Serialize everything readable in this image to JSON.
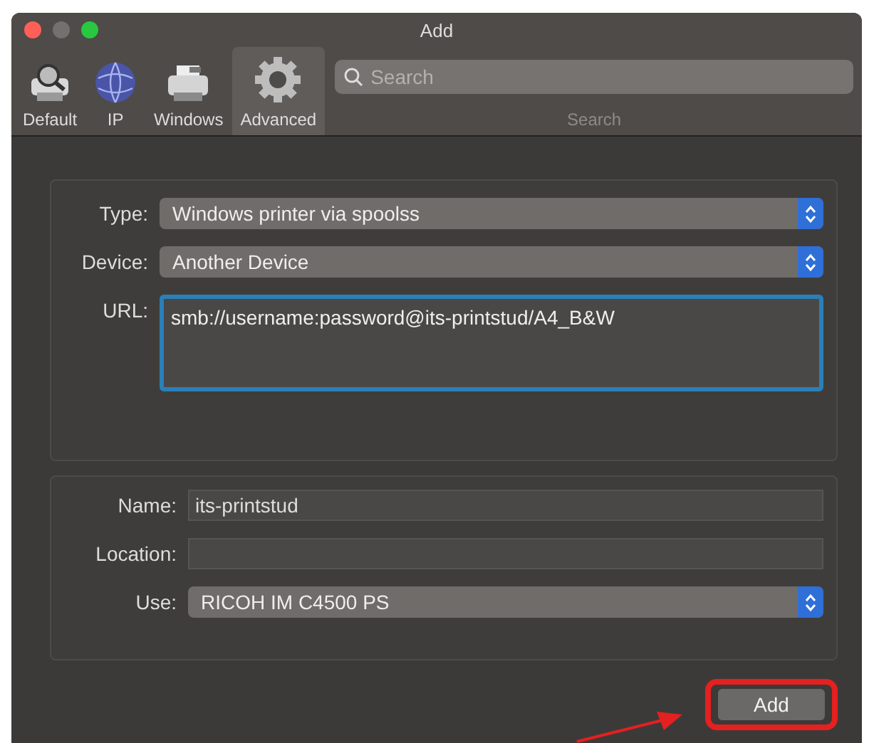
{
  "window": {
    "title": "Add"
  },
  "toolbar": {
    "items": [
      {
        "label": "Default",
        "kind": "default",
        "selected": false
      },
      {
        "label": "IP",
        "kind": "ip",
        "selected": false
      },
      {
        "label": "Windows",
        "kind": "windows",
        "selected": false
      },
      {
        "label": "Advanced",
        "kind": "advanced",
        "selected": true
      }
    ],
    "search": {
      "placeholder": "Search",
      "label": "Search"
    }
  },
  "connection": {
    "rows": [
      {
        "label": "Type:",
        "kind": "popup",
        "value": "Windows printer via spoolss"
      },
      {
        "label": "Device:",
        "kind": "popup",
        "value": "Another Device"
      },
      {
        "label": "URL:",
        "kind": "textarea",
        "value": "smb://username:password@its-printstud/A4_B&W",
        "focused": true
      }
    ]
  },
  "details": {
    "rows": [
      {
        "label": "Name:",
        "kind": "field",
        "value": "its-printstud",
        "focused": false
      },
      {
        "label": "Location:",
        "kind": "field",
        "focused": false
      },
      {
        "label": "Use:",
        "kind": "popup",
        "value": "RICOH IM C4500 PS"
      }
    ]
  },
  "buttons": [
    {
      "label": "Add"
    }
  ]
}
